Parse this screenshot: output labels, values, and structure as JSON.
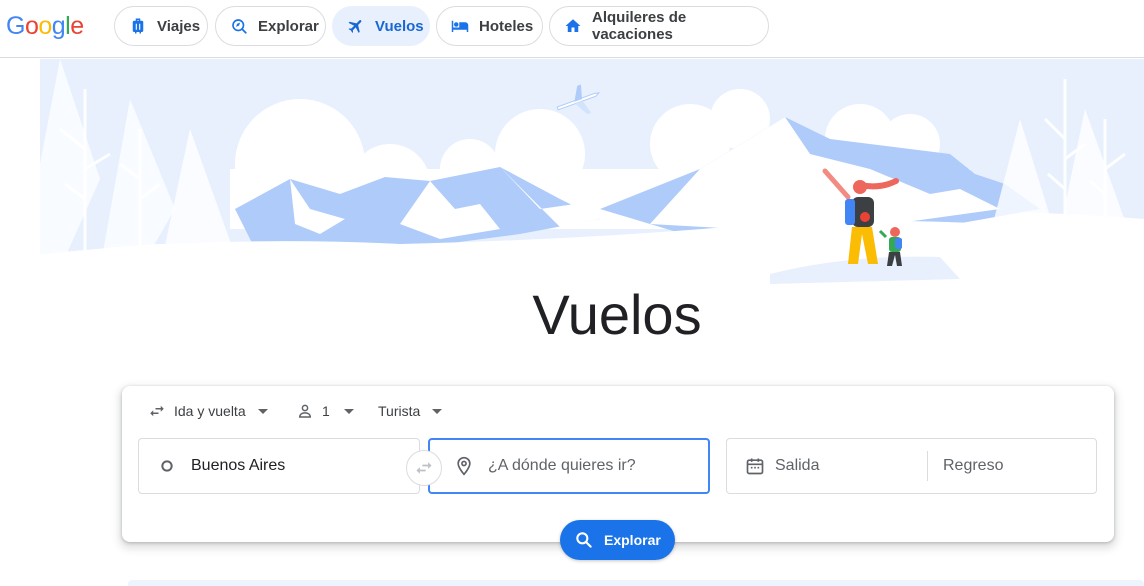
{
  "brand": {
    "logo_letters": [
      "G",
      "o",
      "o",
      "g",
      "l",
      "e"
    ]
  },
  "nav": {
    "items": [
      {
        "label": "Viajes",
        "icon": "suitcase-icon",
        "active": false
      },
      {
        "label": "Explorar",
        "icon": "explore-search-icon",
        "active": false
      },
      {
        "label": "Vuelos",
        "icon": "airplane-icon",
        "active": true
      },
      {
        "label": "Hoteles",
        "icon": "bed-icon",
        "active": false
      },
      {
        "label": "Alquileres de vacaciones",
        "icon": "house-icon",
        "active": false
      }
    ]
  },
  "page": {
    "title": "Vuelos"
  },
  "search": {
    "trip_type": "Ida y vuelta",
    "passengers": "1",
    "cabin_class": "Turista",
    "origin": "Buenos Aires",
    "destination_placeholder": "¿A dónde quieres ir?",
    "departure_placeholder": "Salida",
    "return_placeholder": "Regreso",
    "submit_label": "Explorar"
  },
  "colors": {
    "accent": "#1a73e8",
    "active_chip_bg": "#e8f0fe",
    "illustration_blue": "#aecbfa",
    "illustration_light": "#e8f0fe"
  }
}
